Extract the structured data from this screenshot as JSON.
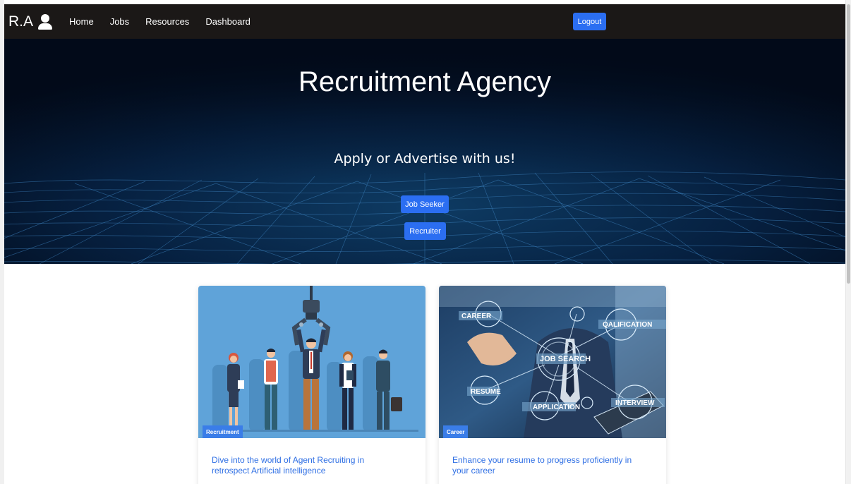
{
  "navbar": {
    "brand": "R.A",
    "links": [
      "Home",
      "Jobs",
      "Resources",
      "Dashboard"
    ],
    "logout_label": "Logout"
  },
  "hero": {
    "title": "Recruitment Agency",
    "subtitle": "Apply or Advertise with us!",
    "job_seeker_label": "Job Seeker",
    "recruiter_label": "Recruiter"
  },
  "cards": [
    {
      "badge": "Recruitment",
      "text": "Dive into the world of Agent Recruiting in retrospect Artificial intelligence"
    },
    {
      "badge": "Career",
      "text": "Enhance your resume to progress proficiently in your career",
      "image_tags": [
        "CAREER",
        "QALIFICATION",
        "JOB SEARCH",
        "RESUME",
        "APPLICATION",
        "INTERVIEW"
      ]
    }
  ],
  "colors": {
    "accent": "#2b6ef2",
    "navbar_bg": "#1b1817",
    "hero_bg": "#020a19",
    "link": "#2f6fe4"
  }
}
